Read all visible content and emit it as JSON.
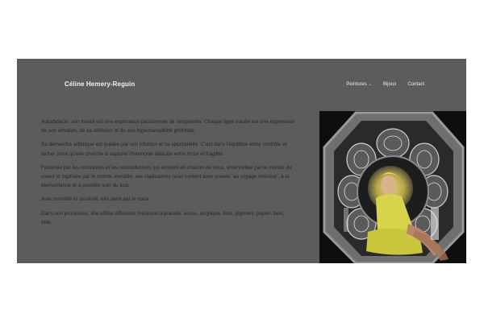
{
  "site": {
    "title": "Céline Hemery-Reguin"
  },
  "nav": {
    "items": [
      {
        "label": "Peintures",
        "has_dropdown": true,
        "icon": "chevron-down-icon"
      },
      {
        "label": "Bijoux"
      },
      {
        "label": "Contact"
      }
    ]
  },
  "content": {
    "paragraphs": [
      "Autodidacte, son travail est une exploration passionnée de l'empreinte. Chaque ligne tracée est une expression de son émotion, de sa réflexion et de son hypersensibilité profonde.",
      "Sa démarche artistique est guidée par son intuition et sa spontanéité. C'est dans l'équilibre entre contrôle et lâcher prise qu'elle cherche à capturer l'harmonie délicate entre force et fragilité.",
      "Fascinée par les contrastes et les contradictions qui existent en chacun de nous, émerveillée par le monde du vivant et captivée par le monde invisible, ses réalisations nous invitent avec poésie `au voyage intérieur', à la bienveillance et à prendre soin du tout.",
      "Avec humilité et sincérité, elle peint par le cœur.",
      "Dans son processus, elle utilise différents médiums aquarelle, encre, acrylique, liant, pigment, papier, bois, toile..."
    ]
  },
  "colors": {
    "overlay": "#5c5c5c",
    "page_background": "#ffffff",
    "body_text": "#262626",
    "header_text": "#f2f2f2"
  }
}
